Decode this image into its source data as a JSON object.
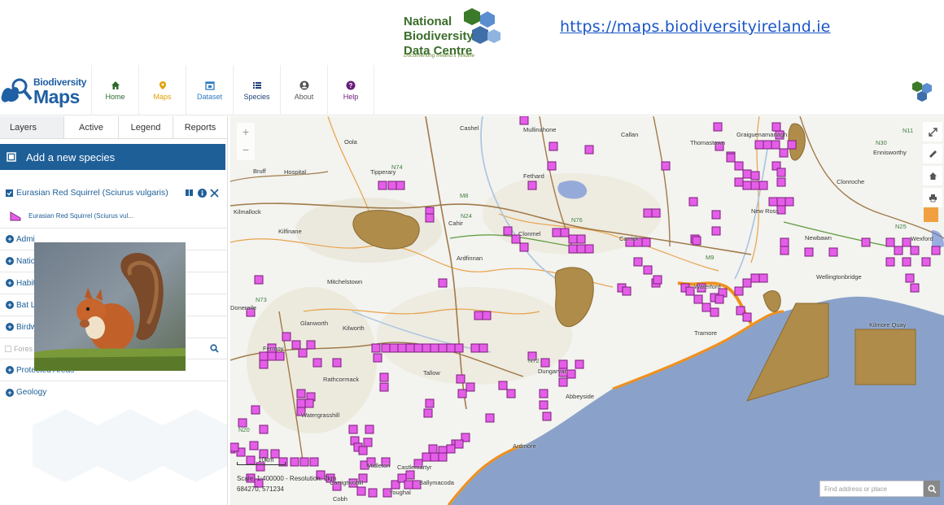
{
  "banner": {
    "logo_line1": "National",
    "logo_line2": "Biodiversity",
    "logo_line3": "Data Centre",
    "tagline": "Documenting Ireland's Wildlife",
    "url": "https://maps.biodiversityireland.ie"
  },
  "app": {
    "logo_small": "Biodiversity",
    "logo_big": "Maps"
  },
  "nav": [
    {
      "label": "Home",
      "icon": "home-icon",
      "color": "#2d6a2d"
    },
    {
      "label": "Maps",
      "icon": "map-pin-icon",
      "color": "#e0a000"
    },
    {
      "label": "Dataset",
      "icon": "dataset-icon",
      "color": "#2b7bbf"
    },
    {
      "label": "Species",
      "icon": "list-icon",
      "color": "#1e3f7a"
    },
    {
      "label": "About",
      "icon": "user-icon",
      "color": "#555555"
    },
    {
      "label": "Help",
      "icon": "help-icon",
      "color": "#6a1b7a"
    }
  ],
  "tabs": [
    "Layers",
    "Active",
    "Legend",
    "Reports"
  ],
  "add_species": "Add a new species",
  "layer": {
    "title": "Eurasian Red Squirrel (Sciurus vulgaris)",
    "legend": "Eurasian Red Squirrel (Sciurus vul..."
  },
  "groups": [
    "Admi",
    "Natio",
    "Habit",
    "Bat L",
    "Birdw"
  ],
  "filter_placeholder": "Fores",
  "groups_bottom": [
    "Protected Areas",
    "Geology"
  ],
  "map": {
    "zoom_in": "+",
    "zoom_out": "−",
    "scale_bar": "10km",
    "scale_text": "Scale: 1:400000 - Resolution: 2km",
    "coords": "684270, 571234",
    "search_placeholder": "Find address or place",
    "places": [
      "Mullinahone",
      "Callan",
      "Graiguenamanagh",
      "Cashel",
      "Thomastown",
      "Ennisworthy",
      "Oola",
      "Tipperary",
      "Fethard",
      "Clonroche",
      "Bruff",
      "Hospital",
      "New Ross",
      "Kilmallock",
      "Cahir",
      "Kilfinane",
      "Clonmel",
      "Carrick",
      "Newbawn",
      "Wexford",
      "Ardfinnan",
      "Mitchelstown",
      "Waterford",
      "Wellingtonbridge",
      "Doneraile",
      "Glanworth",
      "Kilworth",
      "Tramore",
      "Kilmore Quay",
      "Fermoy",
      "Dungarvan",
      "Rathcormack",
      "Tallow",
      "Abbeyside",
      "Watergrasshill",
      "Ardmore",
      "Midleton",
      "Castlemartyr",
      "Carrigtwohill",
      "Cobh",
      "Youghal",
      "Ballymacoda"
    ],
    "roads": [
      "N74",
      "M8",
      "N24",
      "N76",
      "N30",
      "N11",
      "N25",
      "M9",
      "N73",
      "N72",
      "N20"
    ]
  },
  "colors": {
    "accent": "#1e5f98",
    "record": "#e45ee8",
    "protected": "#b08c4a",
    "sea": "#8aa2c9"
  }
}
